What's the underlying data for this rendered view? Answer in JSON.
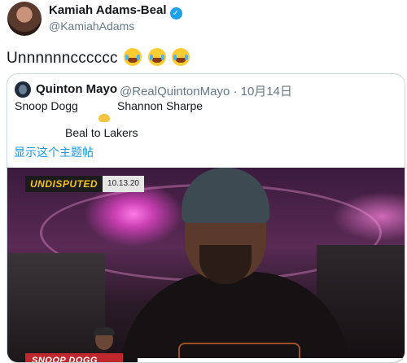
{
  "tweet": {
    "author_name": "Kamiah Adams-Beal",
    "verified_mark": "✓",
    "author_handle": "@KamiahAdams",
    "text": "Unnnnnncccccc",
    "emojis": [
      "face-with-tears-of-joy-icon",
      "face-with-tears-of-joy-icon",
      "face-with-tears-of-joy-icon"
    ]
  },
  "quoted": {
    "author_name": "Quinton Mayo",
    "handle_date": "@RealQuintonMayo · 10月14日",
    "line1_left": "Snoop Dogg",
    "line1_right": "Shannon Sharpe",
    "line2": "Beal to Lakers",
    "show_thread": "显示这个主题帖",
    "video": {
      "bug_label": "UNDISPUTED",
      "bug_date": "10.13.20",
      "lower_third": "SNOOP DOGG"
    }
  },
  "colors": {
    "link": "#1b95e0",
    "verified": "#1da1f2",
    "secondary_text": "#657786",
    "border": "#ccd6dd"
  }
}
